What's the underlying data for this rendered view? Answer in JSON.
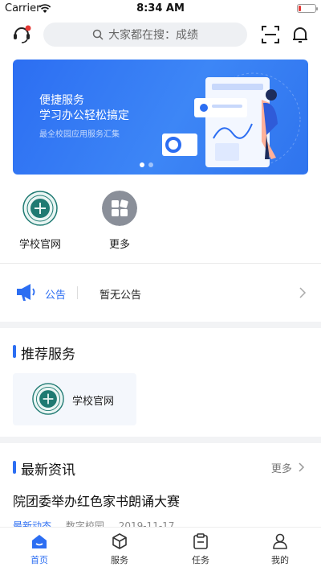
{
  "status_bar": {
    "carrier": "Carrier",
    "time": "8:34 AM"
  },
  "header": {
    "search_placeholder": "大家都在搜：成绩"
  },
  "banner": {
    "line1": "便捷服务",
    "line2": "学习办公轻松搞定",
    "line3": "最全校园应用服务汇集",
    "page_count": 2,
    "active_page": 1
  },
  "quick_apps": [
    {
      "label": "学校官网"
    },
    {
      "label": "更多"
    }
  ],
  "notice": {
    "label": "公告",
    "text": "暂无公告"
  },
  "recommended": {
    "title": "推荐服务",
    "items": [
      {
        "label": "学校官网"
      }
    ]
  },
  "news": {
    "title": "最新资讯",
    "more": "更多",
    "items": [
      {
        "title": "院团委举办红色家书朗诵大赛",
        "tag": "最新动态",
        "source": "数字校园",
        "date": "2019-11-17"
      }
    ]
  },
  "tabbar": {
    "items": [
      {
        "label": "首页",
        "icon": "home-icon"
      },
      {
        "label": "服务",
        "icon": "cube-icon"
      },
      {
        "label": "任务",
        "icon": "clipboard-icon"
      },
      {
        "label": "我的",
        "icon": "user-icon"
      }
    ]
  },
  "colors": {
    "accent": "#2c6ef2",
    "banner": "#3d86f6"
  }
}
